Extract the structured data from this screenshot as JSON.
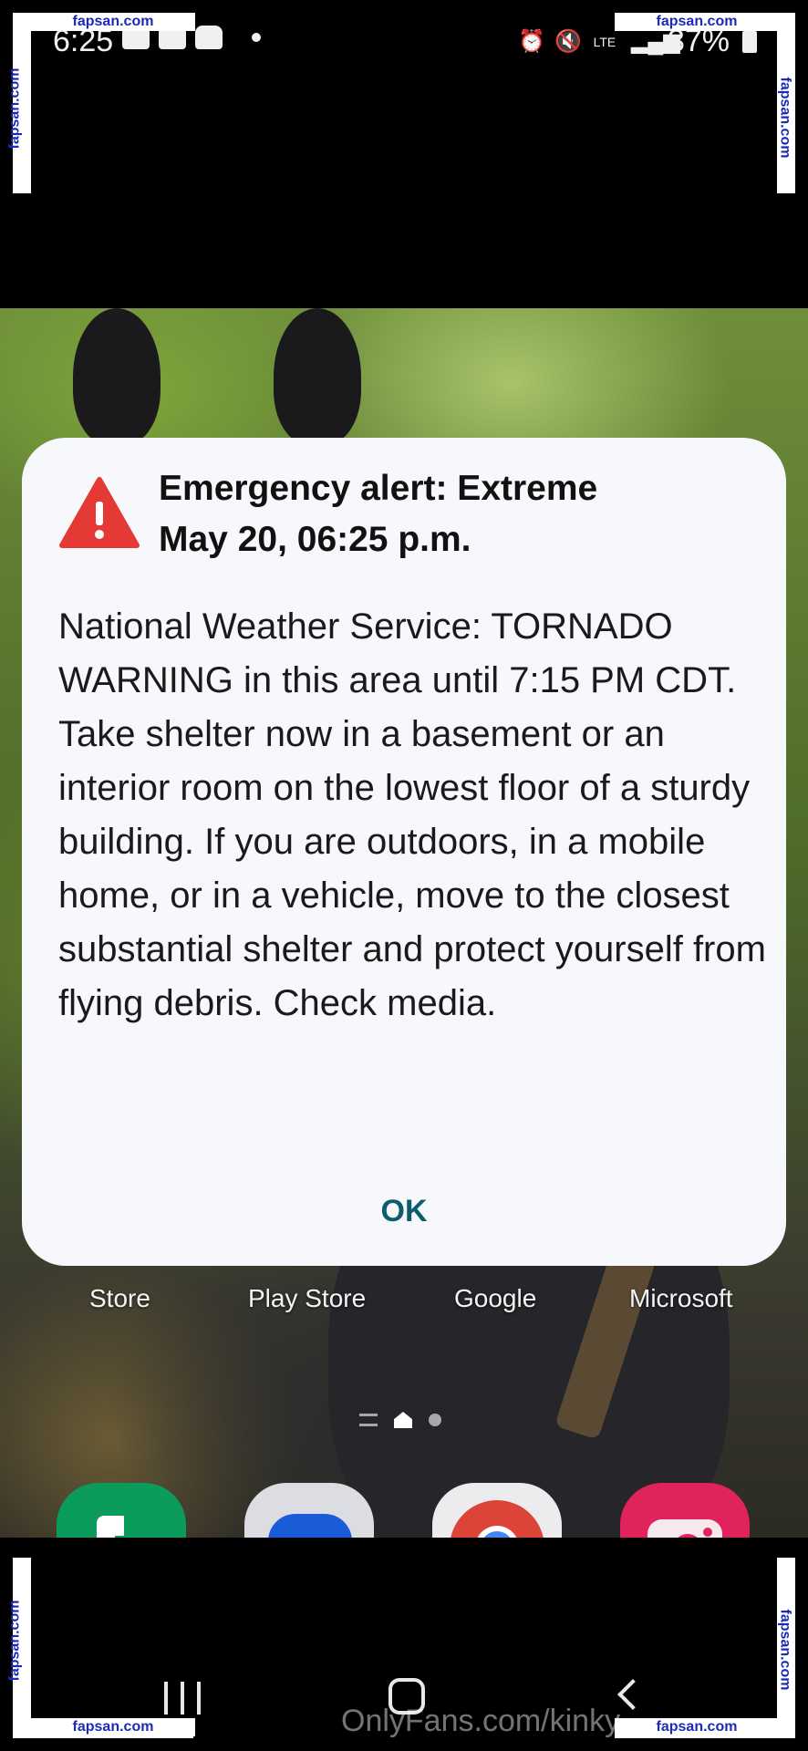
{
  "status_bar": {
    "time": "6:25",
    "battery": "37%",
    "signal_label": "LTE"
  },
  "alert": {
    "title": "Emergency alert: Extreme",
    "datetime": "May 20, 06:25 p.m.",
    "body": "National Weather Service: TORNADO WARNING in this area until 7:15 PM CDT. Take shelter now in a basement or an interior room on the lowest floor of a sturdy building. If you are outdoors, in a mobile home, or in a vehicle, move to the closest substantial shelter and protect yourself from flying debris. Check media.",
    "ok_label": "OK",
    "icon": "warning-triangle-icon",
    "accent_color": "#0c5d6b",
    "icon_color": "#e53935"
  },
  "home": {
    "app_labels": [
      "Store",
      "Play Store",
      "Google",
      "Microsoft"
    ],
    "dock": [
      {
        "name": "Phone",
        "icon": "phone-icon",
        "color": "#0b9b5a"
      },
      {
        "name": "Messages",
        "icon": "messages-icon",
        "color": "#1a73e8"
      },
      {
        "name": "Chrome",
        "icon": "chrome-icon",
        "color": "#4285f4"
      },
      {
        "name": "Camera",
        "icon": "camera-icon",
        "color": "#e0235a"
      }
    ]
  },
  "watermarks": {
    "site": "fapsan.com",
    "footer": "OnlyFans.com/kinky"
  }
}
